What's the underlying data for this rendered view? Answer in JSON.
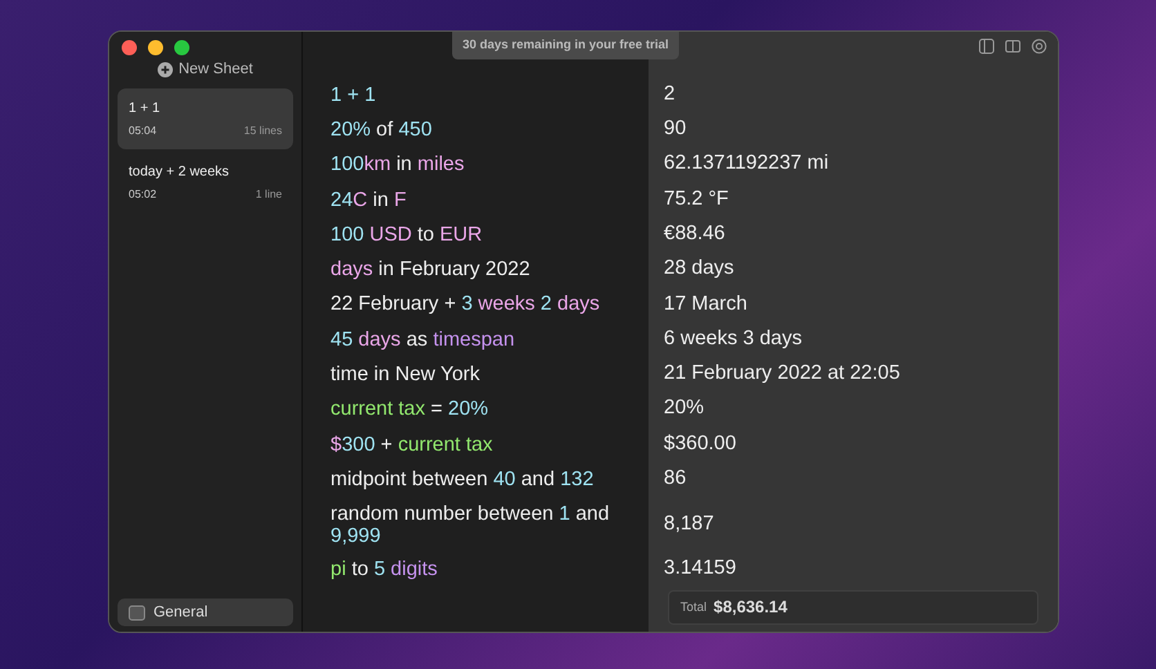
{
  "trial_banner": "30 days remaining in your free trial",
  "sidebar": {
    "new_sheet": "New Sheet",
    "sheets": [
      {
        "title": "1 + 1",
        "time": "05:04",
        "lines": "15 lines",
        "selected": true
      },
      {
        "title": "today + 2 weeks",
        "time": "05:02",
        "lines": "1 line",
        "selected": false
      }
    ],
    "footer": {
      "label": "General"
    }
  },
  "rows": [
    {
      "tokens": [
        {
          "kind": "number",
          "text": "1 + 1"
        }
      ],
      "result": "2"
    },
    {
      "tokens": [
        {
          "kind": "number",
          "text": "20%"
        },
        {
          "kind": "text",
          "text": " of "
        },
        {
          "kind": "number",
          "text": "450"
        }
      ],
      "result": "90"
    },
    {
      "tokens": [
        {
          "kind": "number",
          "text": "100"
        },
        {
          "kind": "unit",
          "text": "km"
        },
        {
          "kind": "text",
          "text": " in "
        },
        {
          "kind": "unit",
          "text": "miles"
        }
      ],
      "result": "62.1371192237 mi"
    },
    {
      "tokens": [
        {
          "kind": "number",
          "text": "24"
        },
        {
          "kind": "unit",
          "text": "C"
        },
        {
          "kind": "text",
          "text": " in "
        },
        {
          "kind": "unit",
          "text": "F"
        }
      ],
      "result": "75.2 °F"
    },
    {
      "tokens": [
        {
          "kind": "number",
          "text": "100 "
        },
        {
          "kind": "unit",
          "text": "USD"
        },
        {
          "kind": "text",
          "text": " to "
        },
        {
          "kind": "unit",
          "text": "EUR"
        }
      ],
      "result": "€88.46"
    },
    {
      "tokens": [
        {
          "kind": "unit",
          "text": "days"
        },
        {
          "kind": "text",
          "text": " in February 2022"
        }
      ],
      "result": "28 days"
    },
    {
      "tokens": [
        {
          "kind": "text",
          "text": "22 February + "
        },
        {
          "kind": "number",
          "text": "3 "
        },
        {
          "kind": "unit",
          "text": "weeks"
        },
        {
          "kind": "number",
          "text": " 2 "
        },
        {
          "kind": "unit",
          "text": "days"
        }
      ],
      "result": "17 March"
    },
    {
      "tokens": [
        {
          "kind": "number",
          "text": "45 "
        },
        {
          "kind": "unit",
          "text": "days"
        },
        {
          "kind": "text",
          "text": " as "
        },
        {
          "kind": "function",
          "text": "timespan"
        }
      ],
      "result": "6 weeks 3 days"
    },
    {
      "tokens": [
        {
          "kind": "text",
          "text": "time in New York"
        }
      ],
      "result": "21 February 2022 at 22:05"
    },
    {
      "tokens": [
        {
          "kind": "variable",
          "text": "current tax"
        },
        {
          "kind": "text",
          "text": " = "
        },
        {
          "kind": "number",
          "text": "20%"
        }
      ],
      "result": "20%"
    },
    {
      "tokens": [
        {
          "kind": "unit",
          "text": "$"
        },
        {
          "kind": "number",
          "text": "300"
        },
        {
          "kind": "text",
          "text": " + "
        },
        {
          "kind": "variable",
          "text": "current tax"
        }
      ],
      "result": "$360.00"
    },
    {
      "tokens": [
        {
          "kind": "text",
          "text": "midpoint between "
        },
        {
          "kind": "number",
          "text": "40"
        },
        {
          "kind": "text",
          "text": " and "
        },
        {
          "kind": "number",
          "text": "132"
        }
      ],
      "result": "86"
    },
    {
      "tokens": [
        {
          "kind": "text",
          "text": "random number between "
        },
        {
          "kind": "number",
          "text": "1"
        },
        {
          "kind": "text",
          "text": " and "
        },
        {
          "kind": "number",
          "text": "9,999"
        }
      ],
      "result": "8,187"
    },
    {
      "tokens": [
        {
          "kind": "variable",
          "text": "pi"
        },
        {
          "kind": "text",
          "text": " to "
        },
        {
          "kind": "number",
          "text": "5 "
        },
        {
          "kind": "function",
          "text": "digits"
        }
      ],
      "result": "3.14159"
    }
  ],
  "total": {
    "label": "Total",
    "value": "$8,636.14"
  }
}
